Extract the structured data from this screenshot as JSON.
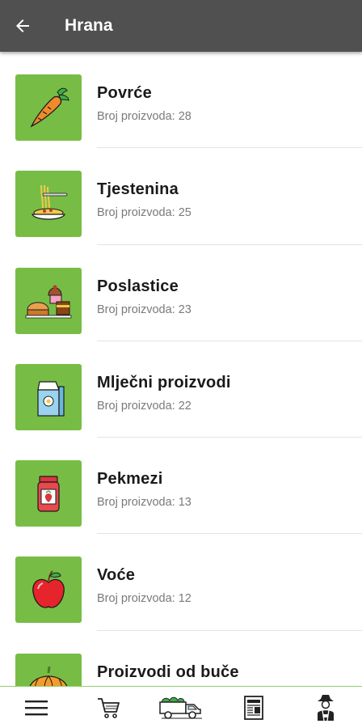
{
  "appbar": {
    "title": "Hrana",
    "back_icon": "arrow-left-icon"
  },
  "categories": [
    {
      "title": "Povrće",
      "count_text": "Broj proizvoda: 28",
      "icon": "carrot-icon"
    },
    {
      "title": "Tjestenina",
      "count_text": "Broj proizvoda: 25",
      "icon": "pasta-icon"
    },
    {
      "title": "Poslastice",
      "count_text": "Broj proizvoda: 23",
      "icon": "pastry-icon"
    },
    {
      "title": "Mlječni proizvodi",
      "count_text": "Broj proizvoda: 22",
      "icon": "milk-carton-icon"
    },
    {
      "title": "Pekmezi",
      "count_text": "Broj proizvoda: 13",
      "icon": "jam-jar-icon"
    },
    {
      "title": "Voće",
      "count_text": "Broj proizvoda: 12",
      "icon": "apple-icon"
    },
    {
      "title": "Proizvodi od buče",
      "count_text": "",
      "icon": "pumpkin-icon"
    }
  ],
  "bottom_nav": [
    {
      "icon": "menu-icon"
    },
    {
      "icon": "cart-icon"
    },
    {
      "icon": "delivery-truck-icon"
    },
    {
      "icon": "newspaper-icon"
    },
    {
      "icon": "farmer-icon"
    }
  ],
  "colors": {
    "appbar": "#505050",
    "thumb_bg": "#77bd45",
    "nav_border": "#8fcf6a"
  }
}
